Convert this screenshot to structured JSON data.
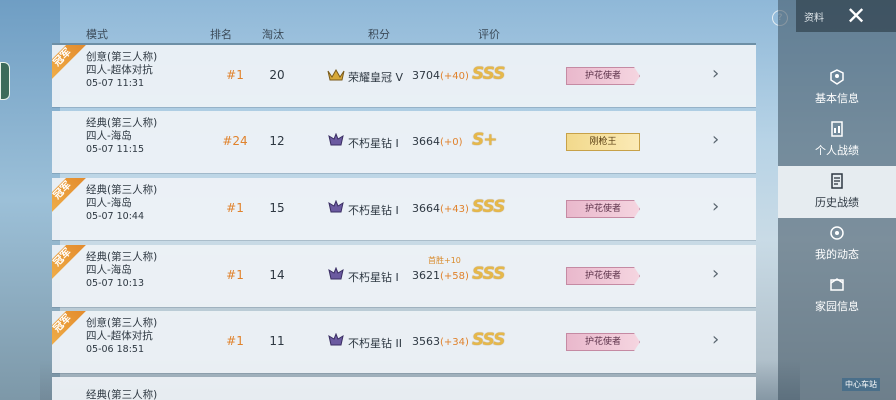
{
  "header": {
    "mode": "模式",
    "rank": "排名",
    "elim": "淘汰",
    "points": "积分",
    "rating": "评价"
  },
  "top_right": {
    "label": "资料",
    "help": "?"
  },
  "rows": [
    {
      "badge": "冠军",
      "mode": "创意(第三人称)",
      "map": "四人-超体对抗",
      "time": "05-07 11:31",
      "rank": "#1",
      "elim": "20",
      "tier": "荣耀皇冠 V",
      "score": "3704",
      "delta": "(+40)",
      "grade": "SSS",
      "title": "护花使者",
      "first_win": ""
    },
    {
      "badge": "",
      "mode": "经典(第三人称)",
      "map": "四人-海岛",
      "time": "05-07 11:15",
      "rank": "#24",
      "elim": "12",
      "tier": "不朽星钻 I",
      "score": "3664",
      "delta": "(+0)",
      "grade": "S+",
      "title": "刚枪王",
      "first_win": ""
    },
    {
      "badge": "冠军",
      "mode": "经典(第三人称)",
      "map": "四人-海岛",
      "time": "05-07 10:44",
      "rank": "#1",
      "elim": "15",
      "tier": "不朽星钻 I",
      "score": "3664",
      "delta": "(+43)",
      "grade": "SSS",
      "title": "护花使者",
      "first_win": ""
    },
    {
      "badge": "冠军",
      "mode": "经典(第三人称)",
      "map": "四人-海岛",
      "time": "05-07 10:13",
      "rank": "#1",
      "elim": "14",
      "tier": "不朽星钻 I",
      "score": "3621",
      "delta": "(+58)",
      "grade": "SSS",
      "title": "护花使者",
      "first_win": "首胜+10"
    },
    {
      "badge": "冠军",
      "mode": "创意(第三人称)",
      "map": "四人-超体对抗",
      "time": "05-06 18:51",
      "rank": "#1",
      "elim": "11",
      "tier": "不朽星钻 II",
      "score": "3563",
      "delta": "(+34)",
      "grade": "SSS",
      "title": "护花使者",
      "first_win": ""
    }
  ],
  "partial_row": {
    "mode": "经典(第三人称)"
  },
  "sidebar": {
    "items": [
      {
        "label": "基本信息",
        "icon": "basic-info-icon"
      },
      {
        "label": "个人战绩",
        "icon": "personal-record-icon"
      },
      {
        "label": "历史战绩",
        "icon": "history-record-icon"
      },
      {
        "label": "我的动态",
        "icon": "my-feed-icon"
      },
      {
        "label": "家园信息",
        "icon": "home-info-icon"
      }
    ]
  },
  "station_sign": "中心车站",
  "colors": {
    "accent": "#e0822c",
    "badge_pink": "#e9b8cc",
    "badge_gold": "#f2d98c"
  }
}
